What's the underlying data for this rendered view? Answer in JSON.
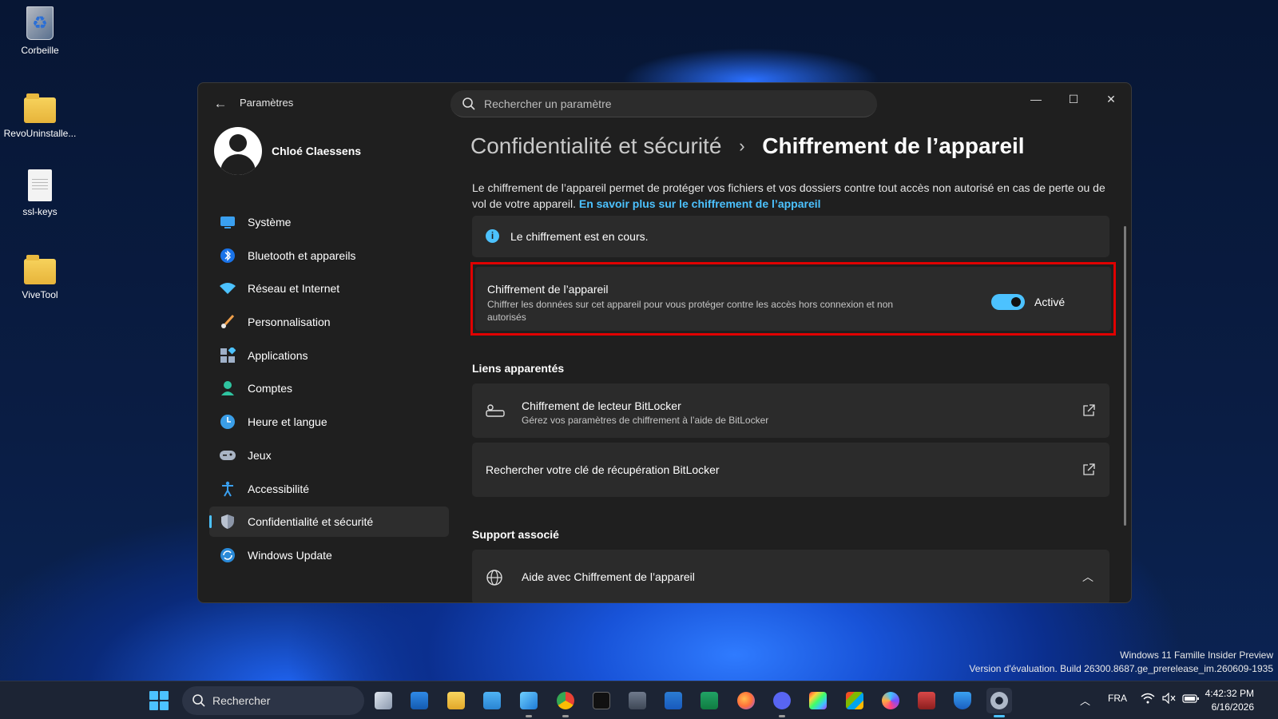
{
  "desktop": {
    "icons": [
      {
        "label": "Corbeille",
        "icon": "recycle-bin-icon"
      },
      {
        "label": "RevoUninstalle...",
        "icon": "folder-icon"
      },
      {
        "label": "ssl-keys",
        "icon": "text-file-icon"
      },
      {
        "label": "ViveTool",
        "icon": "folder-icon"
      }
    ],
    "watermark_line1": "Windows 11 Famille Insider Preview",
    "watermark_line2": "Version d'évaluation. Build 26300.8687.ge_prerelease_im.260609-1935"
  },
  "window": {
    "app_title": "Paramètres",
    "search_placeholder": "Rechercher un paramètre",
    "minimize": "—",
    "maximize": "☐",
    "close": "✕",
    "back": "←"
  },
  "sidebar": {
    "user_name": "Chloé Claessens",
    "items": [
      {
        "label": "Système",
        "icon": "system-icon"
      },
      {
        "label": "Bluetooth et appareils",
        "icon": "bluetooth-icon"
      },
      {
        "label": "Réseau et Internet",
        "icon": "wifi-icon"
      },
      {
        "label": "Personnalisation",
        "icon": "brush-icon"
      },
      {
        "label": "Applications",
        "icon": "apps-icon"
      },
      {
        "label": "Comptes",
        "icon": "accounts-icon"
      },
      {
        "label": "Heure et langue",
        "icon": "clock-globe-icon"
      },
      {
        "label": "Jeux",
        "icon": "gamepad-icon"
      },
      {
        "label": "Accessibilité",
        "icon": "accessibility-icon"
      },
      {
        "label": "Confidentialité et sécurité",
        "icon": "shield-icon",
        "active": true
      },
      {
        "label": "Windows Update",
        "icon": "update-icon"
      }
    ]
  },
  "main": {
    "breadcrumb_parent": "Confidentialité et sécurité",
    "breadcrumb_sep": "›",
    "breadcrumb_current": "Chiffrement de l’appareil",
    "description": "Le chiffrement de l’appareil permet de protéger vos fichiers et vos dossiers contre tout accès non autorisé en cas de perte ou de vol de votre appareil.",
    "learn_more": "En savoir plus sur le chiffrement de l’appareil",
    "info_text": "Le chiffrement est en cours.",
    "encryption": {
      "title": "Chiffrement de l’appareil",
      "subtitle": "Chiffrer les données sur cet appareil pour vous protéger contre les accès hors connexion et non autorisés",
      "toggle_on": true,
      "toggle_label": "Activé"
    },
    "related_links_title": "Liens apparentés",
    "bitlocker_title": "Chiffrement de lecteur BitLocker",
    "bitlocker_sub": "Gérez vos paramètres de chiffrement à l’aide de BitLocker",
    "recovery_key": "Rechercher votre clé de récupération BitLocker",
    "support_title": "Support associé",
    "help_title": "Aide avec Chiffrement de l’appareil"
  },
  "taskbar": {
    "search_label": "Rechercher",
    "language": "FRA",
    "time": "4:42:32 PM",
    "date": "6/16/2026",
    "accent": "#4cc2ff"
  }
}
